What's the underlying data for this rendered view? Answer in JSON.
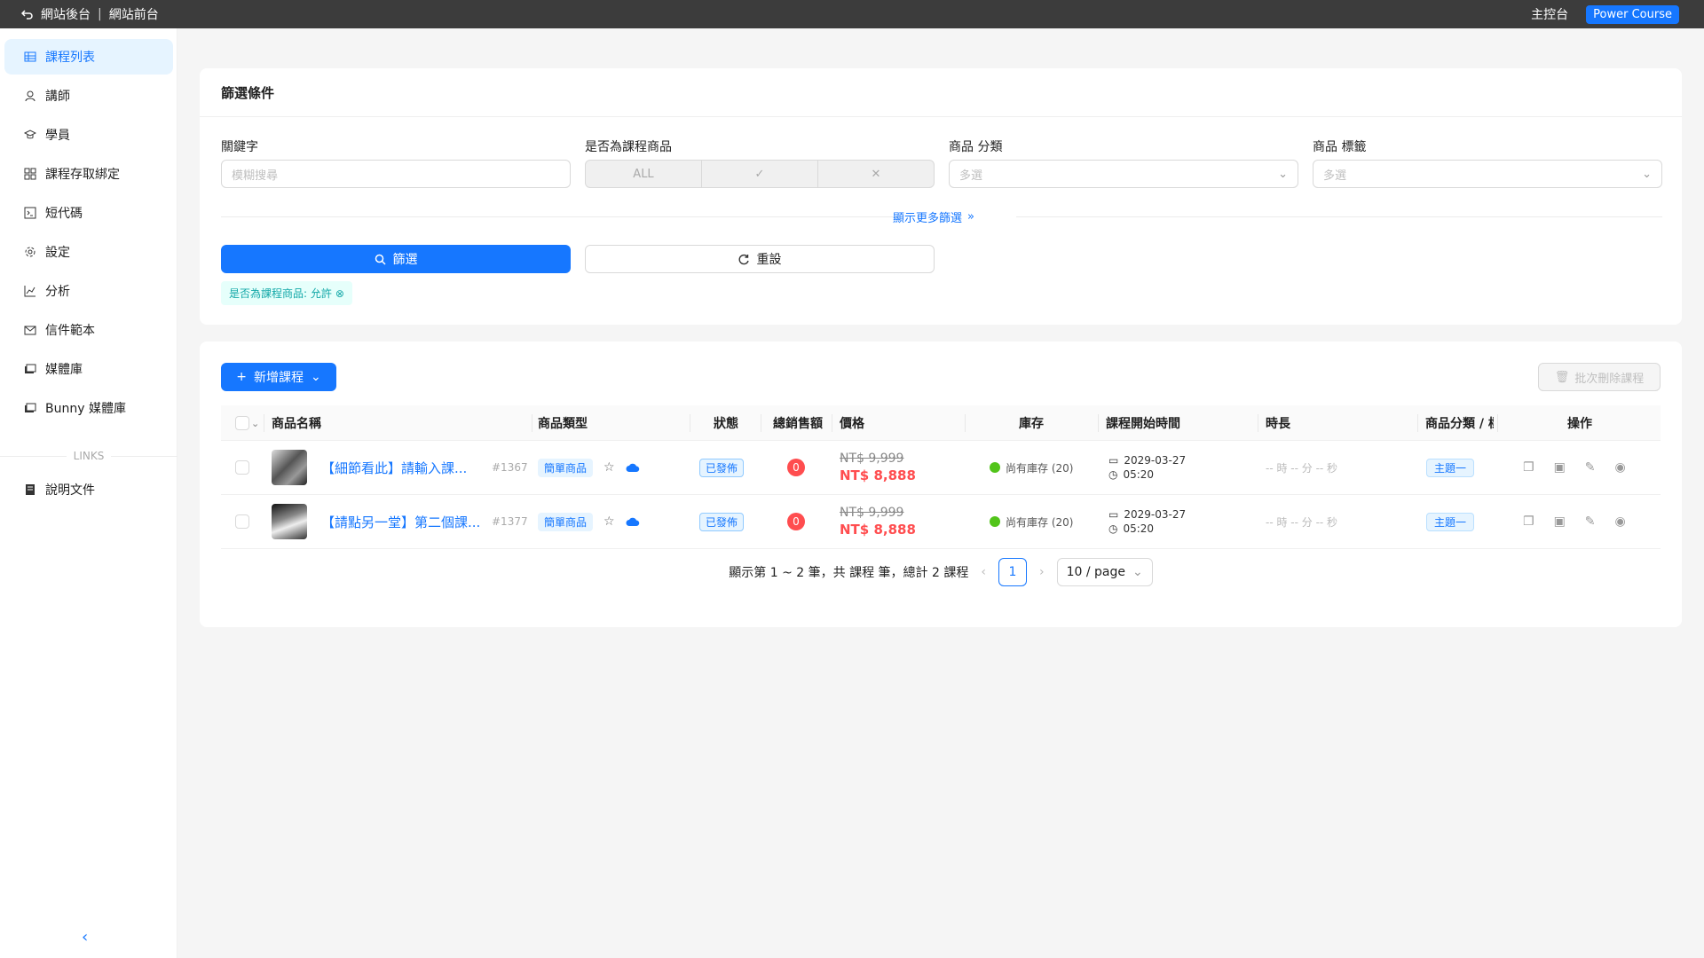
{
  "topbar": {
    "back_label": "網站後台",
    "front_label": "網站前台",
    "dashboard_label": "主控台",
    "brand_label": "Power Course"
  },
  "sidebar": {
    "items": [
      {
        "label": "課程列表",
        "icon": "table-icon"
      },
      {
        "label": "講師",
        "icon": "user-icon"
      },
      {
        "label": "學員",
        "icon": "graduation-icon"
      },
      {
        "label": "課程存取綁定",
        "icon": "apps-icon"
      },
      {
        "label": "短代碼",
        "icon": "code-icon"
      },
      {
        "label": "設定",
        "icon": "gear-icon"
      },
      {
        "label": "分析",
        "icon": "chart-icon"
      },
      {
        "label": "信件範本",
        "icon": "mail-icon"
      },
      {
        "label": "媒體庫",
        "icon": "media-icon"
      },
      {
        "label": "Bunny 媒體庫",
        "icon": "media-icon"
      }
    ],
    "links_label": "LINKS",
    "doc_item": {
      "label": "說明文件",
      "icon": "book-icon"
    },
    "active_index": 0
  },
  "filter": {
    "title": "篩選條件",
    "keyword_label": "關鍵字",
    "keyword_placeholder": "模糊搜尋",
    "is_course_label": "是否為課程商品",
    "segments": [
      "ALL",
      "✓",
      "✕"
    ],
    "category_label": "商品 分類",
    "category_placeholder": "多選",
    "tag_label": "商品 標籤",
    "tag_placeholder": "多選",
    "more_label": "顯示更多篩選",
    "filter_button": "篩選",
    "reset_button": "重設",
    "active_tag": "是否為課程商品: 允許"
  },
  "table": {
    "add_button": "新增課程",
    "batch_delete_button": "批次刪除課程",
    "headers": [
      "商品名稱",
      "商品類型",
      "狀態",
      "總銷售額",
      "價格",
      "庫存",
      "課程開始時間",
      "時長",
      "商品分類 / 標",
      "操作"
    ],
    "rows": [
      {
        "name": "【細節看此】請輸入課...",
        "id": "#1367",
        "type": "簡單商品",
        "status": "已發佈",
        "sales": "0",
        "old_price": "NT$  9,999",
        "new_price": "NT$  8,888",
        "stock": "尚有庫存 (20)",
        "date": "2029-03-27",
        "time": "05:20",
        "duration": "-- 時 -- 分 -- 秒",
        "category": "主題一"
      },
      {
        "name": "【請點另一堂】第二個課...",
        "id": "#1377",
        "type": "簡單商品",
        "status": "已發佈",
        "sales": "0",
        "old_price": "NT$  9,999",
        "new_price": "NT$  8,888",
        "stock": "尚有庫存 (20)",
        "date": "2029-03-27",
        "time": "05:20",
        "duration": "-- 時 -- 分 -- 秒",
        "category": "主題一"
      }
    ]
  },
  "pagination": {
    "summary": "顯示第 1 ~ 2 筆，共 課程 筆，總計 2 課程",
    "current": "1",
    "page_size": "10 / page"
  },
  "colors": {
    "primary": "#1677ff",
    "danger": "#ff4d4f",
    "success": "#52c41a",
    "topbar": "#3c3c3c"
  }
}
